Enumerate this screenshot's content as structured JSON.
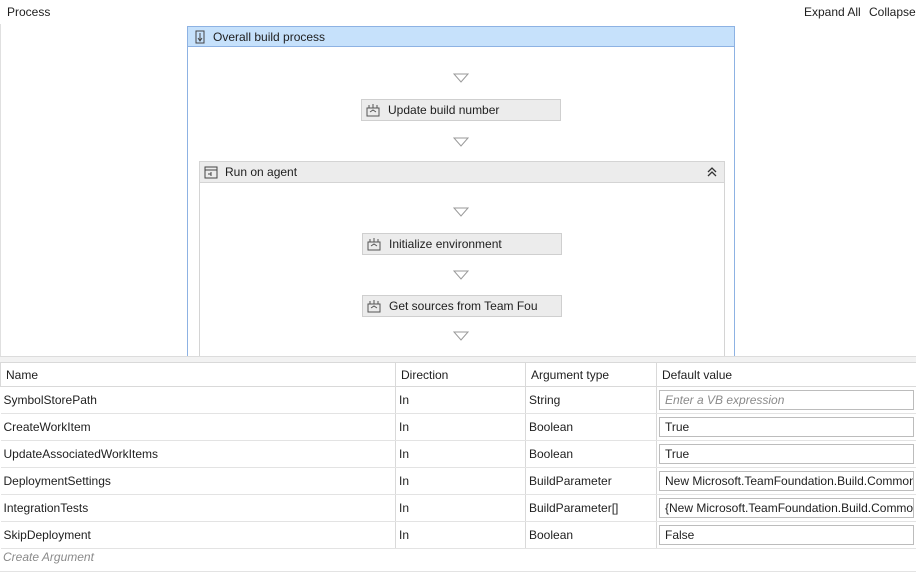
{
  "header": {
    "breadcrumb": "Process",
    "expand_all": "Expand All",
    "collapse": "Collapse"
  },
  "workflow": {
    "outer_title": "Overall build process",
    "activity1": "Update build number",
    "inner_title": "Run on agent",
    "activity2": "Initialize environment",
    "activity3": "Get sources from Team Fou"
  },
  "grid": {
    "columns": [
      "Name",
      "Direction",
      "Argument type",
      "Default value"
    ],
    "rows": [
      {
        "name": "SymbolStorePath",
        "direction": "In",
        "type": "String",
        "default": "",
        "placeholder": "Enter a VB expression"
      },
      {
        "name": "CreateWorkItem",
        "direction": "In",
        "type": "Boolean",
        "default": "True"
      },
      {
        "name": "UpdateAssociatedWorkItems",
        "direction": "In",
        "type": "Boolean",
        "default": "True"
      },
      {
        "name": "DeploymentSettings",
        "direction": "In",
        "type": "BuildParameter",
        "default": "New Microsoft.TeamFoundation.Build.Common"
      },
      {
        "name": "IntegrationTests",
        "direction": "In",
        "type": "BuildParameter[]",
        "default": "{New Microsoft.TeamFoundation.Build.Commo"
      },
      {
        "name": "SkipDeployment",
        "direction": "In",
        "type": "Boolean",
        "default": "False"
      }
    ],
    "create_argument": "Create Argument"
  }
}
